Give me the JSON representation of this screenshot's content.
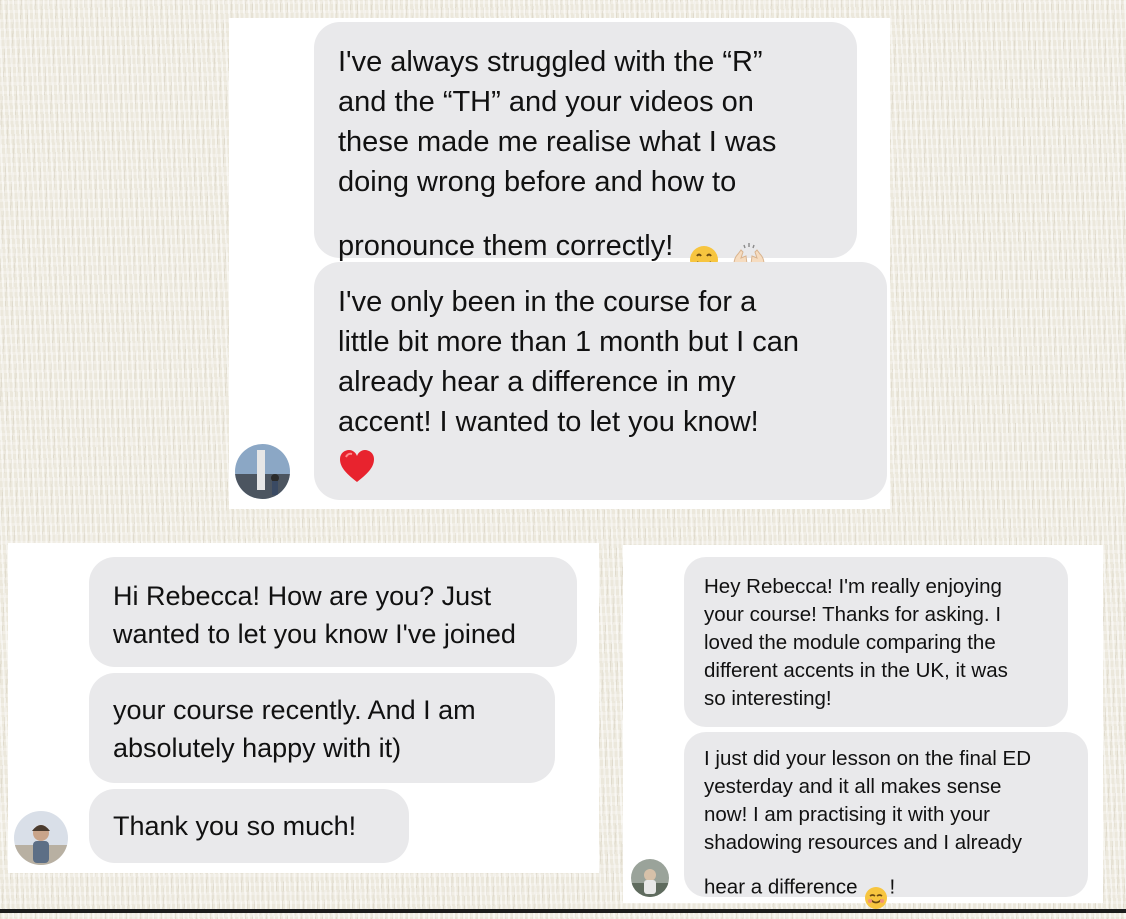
{
  "messages_top": {
    "bubble1_text": "I've always struggled with the “R”\nand the “TH” and your videos on\nthese made me realise what I was\ndoing wrong before and how to\npronounce them correctly!",
    "bubble2_text": "I've only been in the course for a\nlittle bit more than 1 month but I can\nalready hear a difference in my\naccent! I wanted to let you know!",
    "emojis": [
      "hugging-face",
      "raised-hands",
      "red-heart"
    ]
  },
  "messages_left": {
    "bubble1_text": "Hi Rebecca! How are you? Just\nwanted to let you know I've joined",
    "bubble2_text": "your course recently. And I am\nabsolutely happy with it)",
    "bubble3_text": "Thank you so much!"
  },
  "messages_right": {
    "bubble1_text": "Hey Rebecca! I'm really enjoying\nyour course! Thanks for asking. I\nloved the module comparing the\ndifferent accents in the UK, it was\nso interesting!",
    "bubble2_text": "I just did your lesson on the final ED\nyesterday and it all makes sense\nnow! I am practising it with your\nshadowing resources and I already\nhear a difference",
    "bubble2_suffix": "!",
    "emojis": [
      "smiling-face"
    ]
  },
  "colors": {
    "bubble": "#e9e9eb",
    "panel": "#ffffff",
    "heart": "#e8232e",
    "emoji_yellow": "#f7c53f"
  }
}
